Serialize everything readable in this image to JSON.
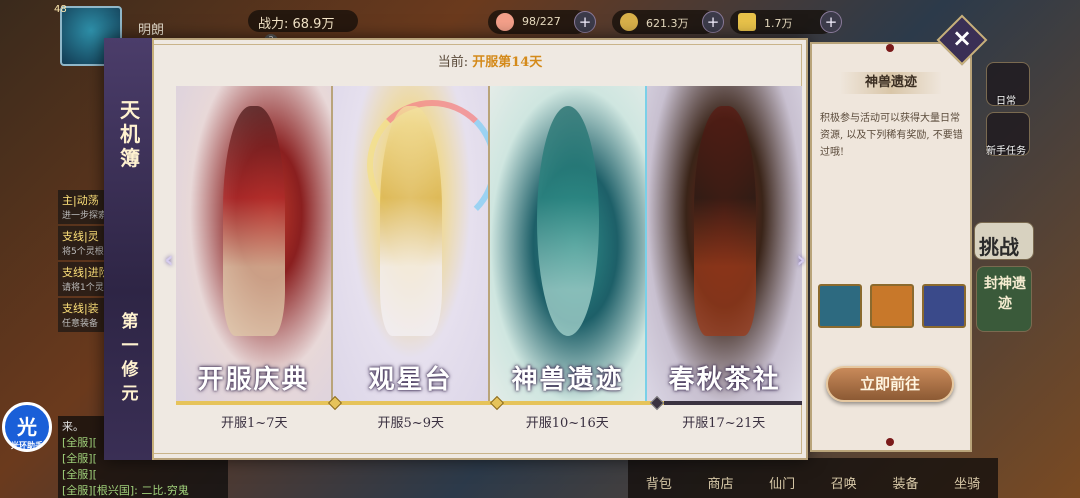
{
  "hud": {
    "level": "48",
    "player_name": "明朗",
    "power_label": "战力: 68.9万",
    "resources": [
      {
        "icon": "peach-icon",
        "value": "98/227",
        "color": "#f4a08a"
      },
      {
        "icon": "coin-icon",
        "value": "621.3万",
        "color": "#d8b04a"
      },
      {
        "icon": "gold-ingot-icon",
        "value": "1.7万",
        "color": "#e8c24a"
      }
    ]
  },
  "side": {
    "daily_label": "日常",
    "newbie_label": "新手任务",
    "challenge_label": "挑战",
    "fengshen_label": "封神遗迹"
  },
  "quests": [
    {
      "title": "主|动荡",
      "desc": "进一步探索"
    },
    {
      "title": "支线|灵",
      "desc": "将5个灵根"
    },
    {
      "title": "支线|进阶",
      "desc": "请将1个灵"
    },
    {
      "title": "支线|装",
      "desc": "任意装备"
    }
  ],
  "chat": {
    "lines": [
      "来。",
      "[全服][",
      "[全服][",
      "[全服][",
      "[全服][根兴国]: 二比.穷鬼"
    ]
  },
  "gx_badge": {
    "glyph": "光",
    "label": "光环助手"
  },
  "bottom_tabs": [
    "背包",
    "商店",
    "仙门",
    "召唤",
    "装备",
    "坐骑"
  ],
  "modal": {
    "spine_title": "天机簿",
    "spine_sub": "第一修元",
    "current_prefix": "当前:",
    "current_value": "开服第14天",
    "cards": [
      {
        "name": "开服庆典",
        "dates": "开服1~7天"
      },
      {
        "name": "观星台",
        "dates": "开服5~9天"
      },
      {
        "name": "神兽遗迹",
        "dates": "开服10~16天"
      },
      {
        "name": "春秋茶社",
        "dates": "开服17~21天"
      }
    ],
    "progress_fraction": 0.78
  },
  "panel": {
    "title": "神兽遗迹",
    "desc": "积极参与活动可以获得大量日常资源, 以及下列稀有奖励, 不要错过哦!",
    "rewards": [
      {
        "icon": "dragon-icon",
        "color": "#2d6a80"
      },
      {
        "icon": "treasure-box-icon",
        "color": "#c8782a"
      },
      {
        "icon": "scroll-book-icon",
        "color": "#3a4a8a"
      }
    ],
    "go_button": "立即前往"
  }
}
